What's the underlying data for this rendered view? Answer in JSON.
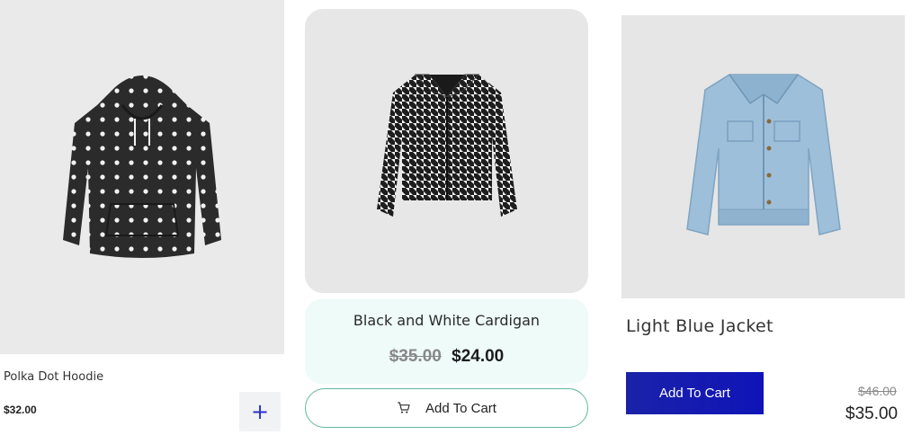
{
  "products": [
    {
      "name": "Polka Dot Hoodie",
      "price": "$32.00",
      "add_label": "+"
    },
    {
      "name": "Black and White Cardigan",
      "old_price": "$35.00",
      "price": "$24.00",
      "add_label": "Add To Cart"
    },
    {
      "name": "Light Blue Jacket",
      "old_price": "$46.00",
      "price": "$35.00",
      "add_label": "Add To Cart"
    }
  ],
  "colors": {
    "accent_blue": "#1b22a8",
    "teal_border": "#5fb9a2",
    "mint_bg": "#eefbf8"
  },
  "icons": [
    "cart-icon",
    "plus-icon"
  ]
}
